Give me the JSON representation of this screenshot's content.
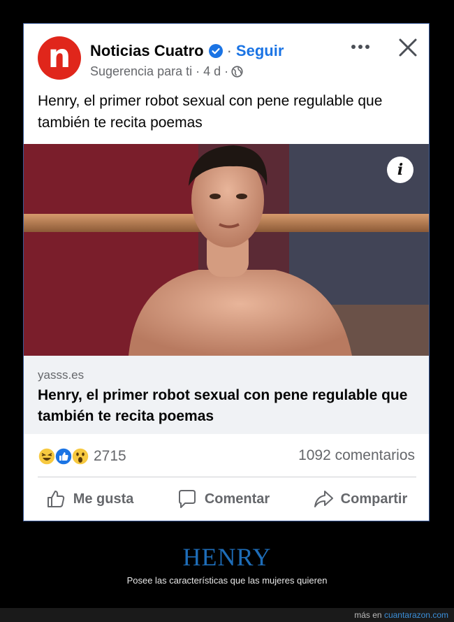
{
  "post": {
    "page_name": "Noticias Cuatro",
    "separator": "·",
    "follow_label": "Seguir",
    "avatar_letter": "n",
    "subline": "Sugerencia para ti · 4 d ·",
    "text": "Henry, el primer robot sexual con pene regulable que también te recita poemas",
    "image_info_label": "i",
    "link": {
      "domain": "yasss.es",
      "title": "Henry, el primer robot sexual con pene regulable que también te recita poemas"
    },
    "reactions": {
      "count": "2715",
      "icons": [
        "haha-icon",
        "like-icon",
        "wow-icon"
      ]
    },
    "comments_count": "1092 comentarios",
    "actions": {
      "like": "Me gusta",
      "comment": "Comentar",
      "share": "Compartir"
    },
    "colors": {
      "brand_red": "#e0261b",
      "facebook_blue": "#1b74e4",
      "secondary_text": "#65676b"
    }
  },
  "meme": {
    "title": "HENRY",
    "subtitle": "Posee las características que las mujeres quieren",
    "footer_prefix": "más en",
    "footer_link": "cuantarazon.com"
  }
}
